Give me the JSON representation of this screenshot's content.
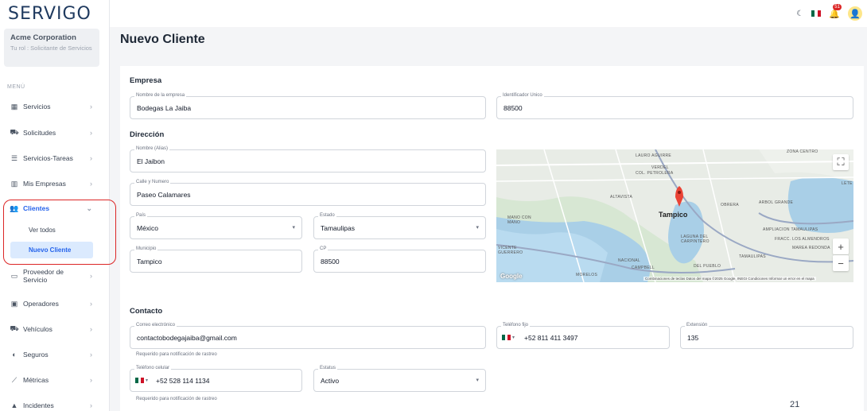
{
  "app": {
    "logo": "SERVIGO"
  },
  "org": {
    "name": "Acme Corporation",
    "role": "Tu rol : Solicitante de Servicios"
  },
  "menu_label": "MENÚ",
  "nav": [
    {
      "label": "Servicios",
      "icon": "briefcase-icon"
    },
    {
      "label": "Solicitudes",
      "icon": "truck-icon"
    },
    {
      "label": "Servicios-Tareas",
      "icon": "list-icon"
    },
    {
      "label": "Mis Empresas",
      "icon": "building-icon"
    },
    {
      "label": "Clientes",
      "icon": "users-icon"
    },
    {
      "label": "Proveedor de Servicio",
      "icon": "id-card-icon"
    },
    {
      "label": "Operadores",
      "icon": "id-badge-icon"
    },
    {
      "label": "Vehículos",
      "icon": "truck-icon"
    },
    {
      "label": "Seguros",
      "icon": "shield-icon"
    },
    {
      "label": "Métricas",
      "icon": "chart-icon"
    },
    {
      "label": "Incidentes",
      "icon": "warning-icon"
    }
  ],
  "clientes_sub": [
    {
      "label": "Ver todos"
    },
    {
      "label": "Nuevo Cliente"
    }
  ],
  "topbar": {
    "notifications": "51"
  },
  "page": {
    "title": "Nuevo Cliente"
  },
  "empresa": {
    "section": "Empresa",
    "name_label": "Nombre de la empresa",
    "name_value": "Bodegas La Jaiba",
    "id_label": "Identificador Unico",
    "id_value": "88500"
  },
  "direccion": {
    "section": "Dirección",
    "alias_label": "Nombre (Alias)",
    "alias_value": "El Jaibon",
    "street_label": "Calle y Numero",
    "street_value": "Paseo Calamares",
    "country_label": "País",
    "country_value": "México",
    "state_label": "Estado",
    "state_value": "Tamaulipas",
    "city_label": "Municipio",
    "city_value": "Tampico",
    "cp_label": "CP",
    "cp_value": "88500"
  },
  "map": {
    "city": "Tampico",
    "labels": [
      "LAURO AGUIRRE",
      "VERDEL",
      "COL. PETROLERA",
      "ZONA CENTRO",
      "LETE",
      "ALTAVISTA",
      "OBRERA",
      "ARBOL GRANDE",
      "MANO CON MANO",
      "NACIONAL",
      "CAMPBELL",
      "DEL PUEBLO",
      "TAMAULIPAS",
      "MORELOS",
      "LAGUNA DEL CARPINTERO",
      "FRACC. LOS ALMENDROS",
      "AMPLIACION TAMAULIPAS",
      "VICENTE GUERRERO",
      "MAREA REDONDA"
    ],
    "footer": "Combinaciones de teclas   Datos del mapa ©2025 Google, INEGI   Condiciones   Informar un error en el mapa",
    "brand": "Google"
  },
  "contacto": {
    "section": "Contacto",
    "email_label": "Correo electrónico",
    "email_value": "contactobodegajaiba@gmail.com",
    "email_help": "Requerido para notificación de rastreo",
    "phone_label": "Teléfono fijo",
    "phone_value": "+52 811 411 3497",
    "ext_label": "Extensión",
    "ext_value": "135",
    "cell_label": "Teléfono celular",
    "cell_value": "+52 528 114 1134",
    "cell_help": "Requerido para notificación de rastreo",
    "status_label": "Estatus",
    "status_value": "Activo"
  },
  "page_number": "21",
  "colors": {
    "accent": "#2563eb",
    "highlight": "#dc2626",
    "brand": "#1f3a5f"
  }
}
